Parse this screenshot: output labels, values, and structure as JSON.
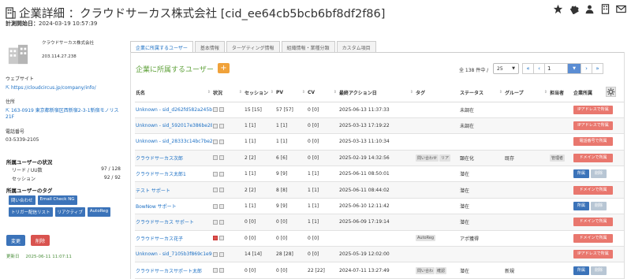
{
  "header": {
    "title": "企業詳細 ：クラウドサーカス株式会社 [cid_ee64cb5bcb6bf8df2f86]",
    "sub_label": "計測開始日：",
    "sub_value": "2024-03-19 10:57:39"
  },
  "header_icons": [
    "star-icon",
    "puzzle-icon",
    "user-icon",
    "building-icon",
    "mail-icon"
  ],
  "company": {
    "name": "クラウドサーカス株式会社",
    "ip": "203.114.27.238",
    "website_label": "ウェブサイト",
    "website": "https://cloudcircus.jp/company/info/",
    "address_label": "住所",
    "address": "163-0919 東京都新宿区西新宿2-3-1新宿モノリス21F",
    "phone_label": "電話番号",
    "phone": "03-5339-2105"
  },
  "user_status": {
    "heading": "所属ユーザーの状況",
    "rows": [
      {
        "label": "リード / UU数",
        "value": "97 / 128"
      },
      {
        "label": "セッション",
        "value": "92 / 92"
      }
    ]
  },
  "user_tags": {
    "heading": "所属ユーザーのタグ",
    "tags": [
      "問い合わせ",
      "Email Check NG",
      "トリガー配信リスト",
      "リアクティブ",
      "AutoReg"
    ]
  },
  "buttons": {
    "edit": "変更",
    "delete": "削除"
  },
  "updated": {
    "label": "更新日",
    "value": "2025-06-11 11:07:11"
  },
  "tabs": [
    "企業に所属するユーザー",
    "基本情報",
    "ターゲティング情報",
    "組織情報・業種分類",
    "カスタム項目"
  ],
  "panel": {
    "heading": "企業に所属するユーザー",
    "add_label": "+",
    "count": "全 138 件中 /",
    "per_page": "25",
    "per_page_caret": "▼",
    "pager": {
      "first": "«",
      "prev": "‹",
      "page": "1",
      "dropdown": "▼",
      "next": "›",
      "last": "»"
    }
  },
  "table": {
    "columns": [
      "氏名",
      "状況",
      "セッション",
      "PV",
      "CV",
      "最終アクション日",
      "タグ",
      "ステータス",
      "グループ",
      "担当者",
      "企業所属"
    ],
    "rows": [
      {
        "name": "Unknown - sid_d262fd582a245ba",
        "flag": "",
        "session": "15 [15]",
        "pv": "57 [57]",
        "cv": "0 [0]",
        "date": "2025-06-13 11:37:33",
        "tags": [],
        "status": "未調在",
        "group": "",
        "owner": "",
        "action": "IPアドレスで所属"
      },
      {
        "name": "Unknown - sid_592017e386be28",
        "flag": "",
        "session": "1 [1]",
        "pv": "1 [1]",
        "cv": "0 [0]",
        "date": "2025-03-13 17:19:22",
        "tags": [],
        "status": "未調在",
        "group": "",
        "owner": "",
        "action": "IPアドレスで所属"
      },
      {
        "name": "Unknown - sid_28333c14bc7be2",
        "flag": "",
        "session": "1 [1]",
        "pv": "1 [1]",
        "cv": "0 [0]",
        "date": "2025-03-13 11:10:34",
        "tags": [],
        "status": "",
        "group": "",
        "owner": "",
        "action": "電話番号で所属"
      },
      {
        "name": "クラウドサーカス次郎",
        "flag": "",
        "session": "2 [2]",
        "pv": "6 [6]",
        "cv": "0 [0]",
        "date": "2025-02-19 14:32:56",
        "tags": [
          "問い合わせ",
          "リア"
        ],
        "status": "顕在化",
        "group": "既存",
        "owner": "管理者",
        "action": "ドメインで所属"
      },
      {
        "name": "クラウドサーカス太郎1",
        "flag": "",
        "session": "1 [1]",
        "pv": "9 [9]",
        "cv": "1 [1]",
        "date": "2025-06-11 08:50:01",
        "tags": [],
        "status": "潜在",
        "group": "",
        "owner": "",
        "action": "所属|削除"
      },
      {
        "name": "テスト サポート",
        "flag": "",
        "session": "2 [2]",
        "pv": "8 [8]",
        "cv": "1 [1]",
        "date": "2025-06-11 08:44:02",
        "tags": [],
        "status": "潜在",
        "group": "",
        "owner": "",
        "action": "ドメインで所属"
      },
      {
        "name": "BowNow サポート",
        "flag": "",
        "session": "1 [1]",
        "pv": "9 [9]",
        "cv": "1 [1]",
        "date": "2025-06-10 12:11:42",
        "tags": [],
        "status": "潜在",
        "group": "",
        "owner": "",
        "action": "所属|削除"
      },
      {
        "name": "クラウドサーカス サポート",
        "flag": "",
        "session": "0 [0]",
        "pv": "0 [0]",
        "cv": "1 [1]",
        "date": "2025-06-09 17:19:14",
        "tags": [],
        "status": "潜在",
        "group": "",
        "owner": "",
        "action": "ドメインで所属"
      },
      {
        "name": "クラウドサーカス花子",
        "flag": "red",
        "session": "0 [0]",
        "pv": "0 [0]",
        "cv": "0 [0]",
        "date": "",
        "tags": [
          "AutoReg"
        ],
        "status": "アポ獲得",
        "group": "",
        "owner": "",
        "action": "ドメインで所属"
      },
      {
        "name": "Unknown - sid_7105b3f869c1e9c",
        "flag": "",
        "session": "14 [14]",
        "pv": "28 [28]",
        "cv": "0 [0]",
        "date": "2025-05-19 12:02:00",
        "tags": [],
        "status": "",
        "group": "",
        "owner": "",
        "action": "IPアドレスで所属"
      },
      {
        "name": "クラウドサーカスサポート太郎",
        "flag": "",
        "session": "0 [0]",
        "pv": "0 [0]",
        "cv": "22 [22]",
        "date": "2024-07-11 13:27:49",
        "tags": [
          "問い合わ",
          "確認"
        ],
        "status": "潜在",
        "group": "新規",
        "owner": "",
        "action": "所属|削除"
      }
    ]
  },
  "colors": {
    "link": "#1b6fc4",
    "green_heading": "#5fa13a",
    "tag_blue": "#3b73b9",
    "action_red": "#e9776e",
    "add_orange": "#f0a23a",
    "delete_red": "#d9534f"
  }
}
